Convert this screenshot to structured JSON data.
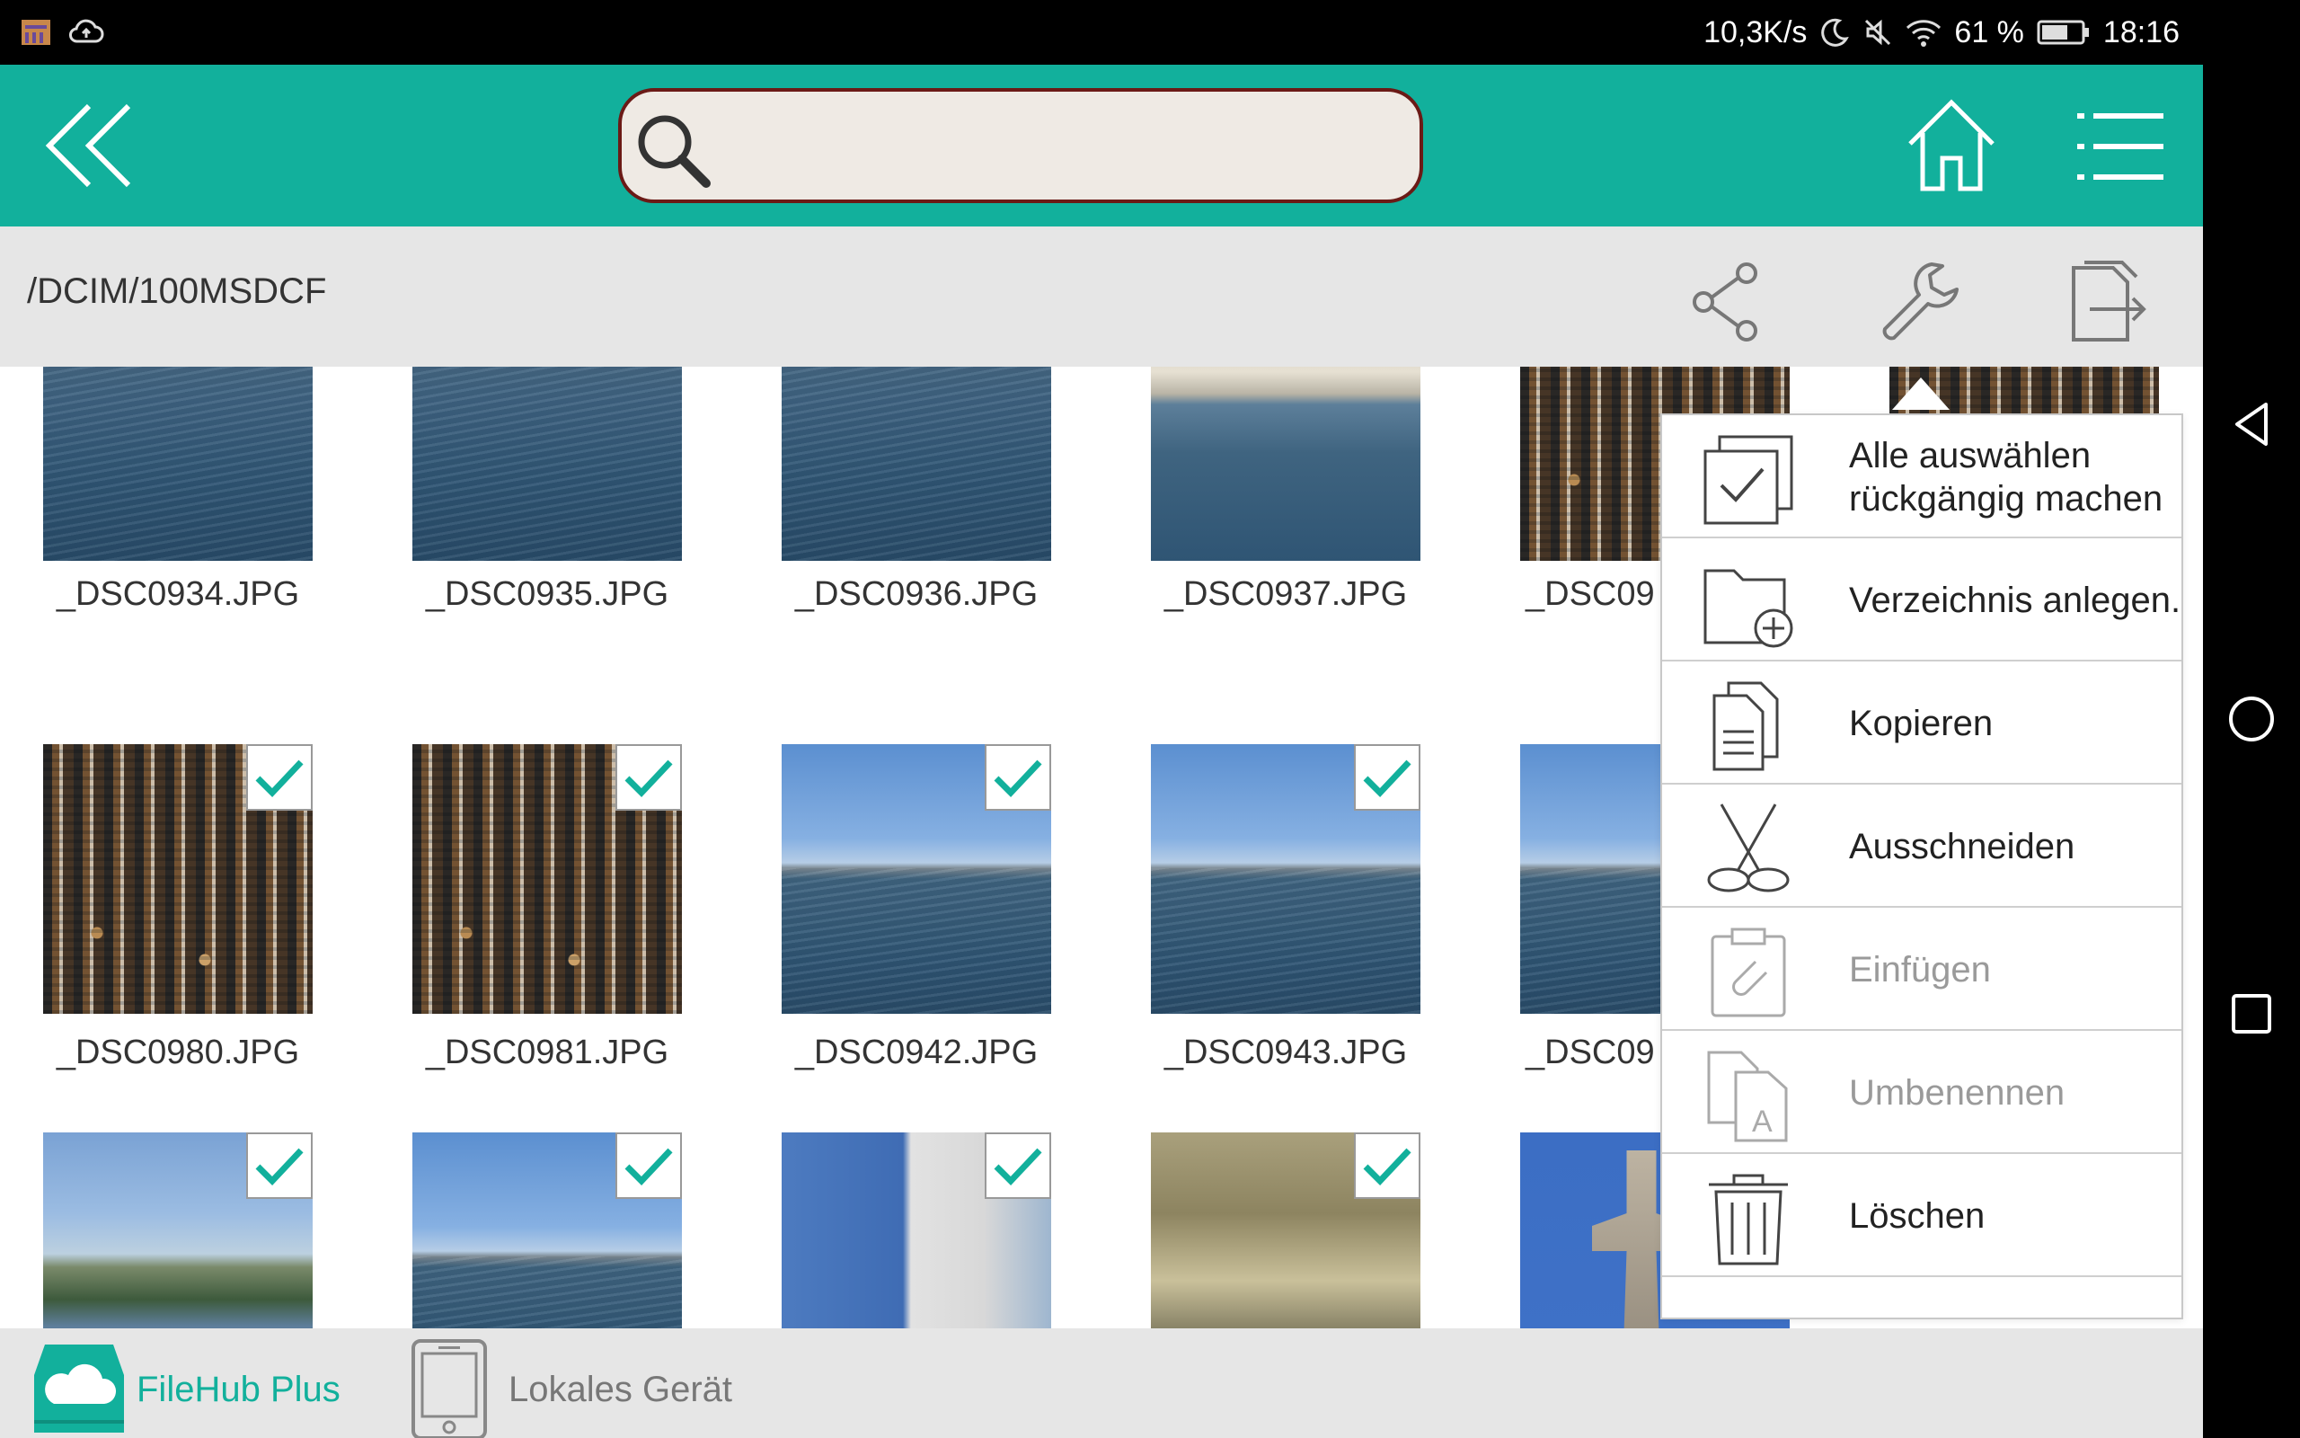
{
  "status_bar": {
    "network_speed": "10,3K/s",
    "battery_percent": "61 %",
    "time": "18:16"
  },
  "toolbar": {
    "search_placeholder": ""
  },
  "pathbar": {
    "path": "/DCIM/100MSDCF"
  },
  "gallery": {
    "files": [
      {
        "name": "_DSC0934.JPG",
        "checked": false
      },
      {
        "name": "_DSC0935.JPG",
        "checked": false
      },
      {
        "name": "_DSC0936.JPG",
        "checked": false
      },
      {
        "name": "_DSC0937.JPG",
        "checked": false
      },
      {
        "name": "_DSC09",
        "checked": false
      },
      {
        "name": "",
        "checked": false
      },
      {
        "name": "_DSC0980.JPG",
        "checked": true
      },
      {
        "name": "_DSC0981.JPG",
        "checked": true
      },
      {
        "name": "_DSC0942.JPG",
        "checked": true
      },
      {
        "name": "_DSC0943.JPG",
        "checked": true
      },
      {
        "name": "_DSC09",
        "checked": false
      },
      {
        "name": "",
        "checked": true
      },
      {
        "name": "",
        "checked": true
      },
      {
        "name": "",
        "checked": true
      },
      {
        "name": "",
        "checked": true
      },
      {
        "name": "",
        "checked": false
      }
    ]
  },
  "context_menu": {
    "items": [
      {
        "label": "Alle auswählen rückgängig machen",
        "icon": "checkbox-icon",
        "enabled": true
      },
      {
        "label": "Verzeichnis anlegen.",
        "icon": "new-folder-icon",
        "enabled": true
      },
      {
        "label": "Kopieren",
        "icon": "copy-icon",
        "enabled": true
      },
      {
        "label": "Ausschneiden",
        "icon": "scissors-icon",
        "enabled": true
      },
      {
        "label": "Einfügen",
        "icon": "paste-icon",
        "enabled": false
      },
      {
        "label": "Umbenennen",
        "icon": "rename-icon",
        "enabled": false
      },
      {
        "label": "Löschen",
        "icon": "trash-icon",
        "enabled": true
      }
    ]
  },
  "bottom_tabs": {
    "filehub": "FileHub Plus",
    "local": "Lokales Gerät"
  },
  "colors": {
    "accent": "#12b09c",
    "search_border": "#6b1a16"
  }
}
